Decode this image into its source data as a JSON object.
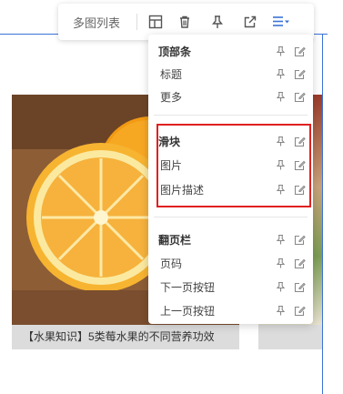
{
  "toolbar": {
    "title": "多图列表",
    "icons": [
      "layout-icon",
      "trash-icon",
      "pin-icon",
      "open-external-icon",
      "list-settings-icon"
    ],
    "active_color": "#3b73d6"
  },
  "menu": {
    "groups": [
      {
        "title": "顶部条",
        "items": [
          "标题",
          "更多"
        ]
      },
      {
        "title": "滑块",
        "items": [
          "图片",
          "图片描述"
        ]
      },
      {
        "title": "翻页栏",
        "items": [
          "页码",
          "下一页按钮",
          "上一页按钮"
        ]
      }
    ]
  },
  "cards": [
    {
      "caption": "【水果知识】5类莓水果的不同营养功效"
    },
    {
      "caption": ""
    }
  ],
  "colors": {
    "accent": "#3b73d6",
    "highlight": "#e02020"
  }
}
